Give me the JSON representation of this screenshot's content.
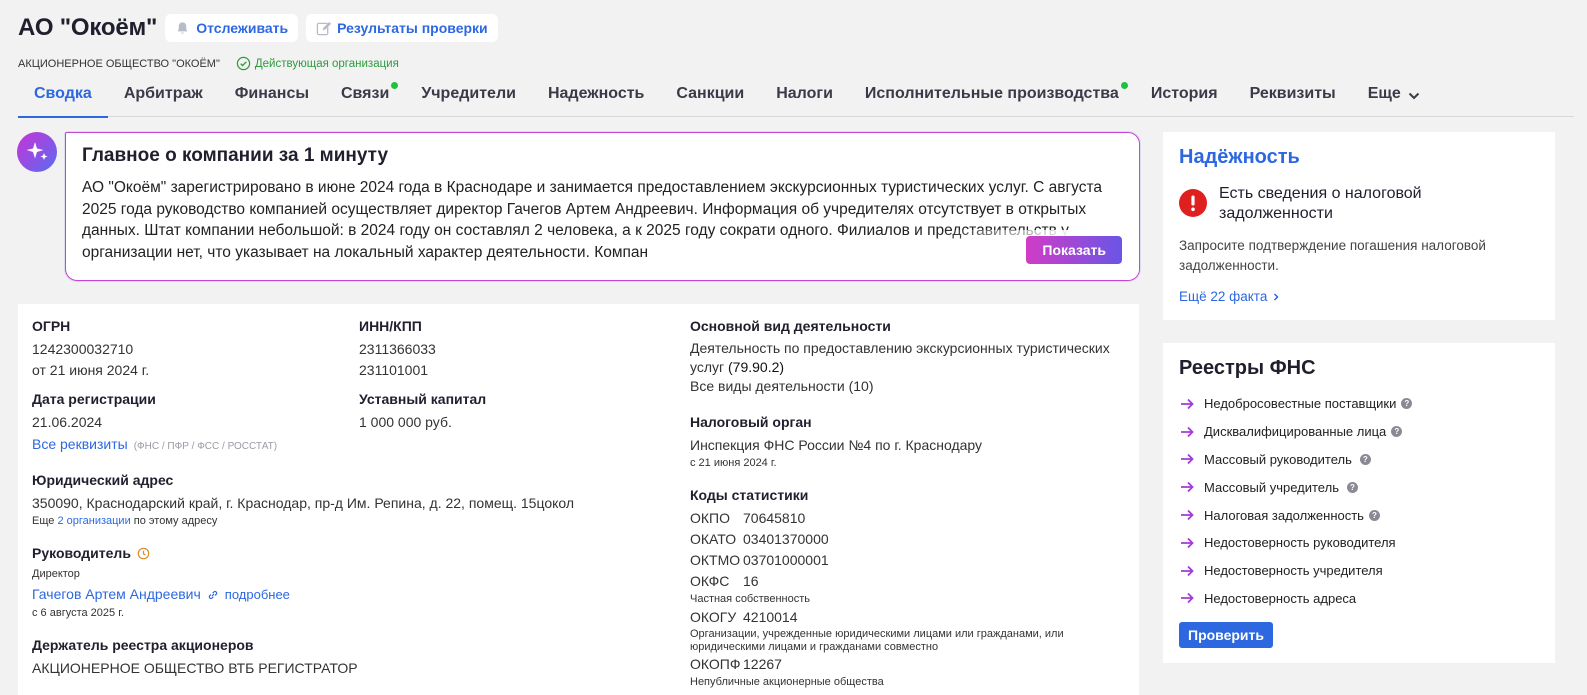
{
  "header": {
    "company_name": "АО \"Окоём\"",
    "track_label": "Отслеживать",
    "results_label": "Результаты проверки",
    "full_name": "АКЦИОНЕРНОЕ ОБЩЕСТВО \"ОКОЁМ\"",
    "status": "Действующая организация"
  },
  "tabs": [
    {
      "label": "Сводка"
    },
    {
      "label": "Арбитраж"
    },
    {
      "label": "Финансы"
    },
    {
      "label": "Связи"
    },
    {
      "label": "Учредители"
    },
    {
      "label": "Надежность"
    },
    {
      "label": "Санкции"
    },
    {
      "label": "Налоги"
    },
    {
      "label": "Исполнительные производства"
    },
    {
      "label": "История"
    },
    {
      "label": "Реквизиты"
    },
    {
      "label": "Еще"
    }
  ],
  "ai_summary": {
    "title": "Главное о компании за 1 минуту",
    "text": "АО \"Окоём\" зарегистрировано в июне 2024 года в Краснодаре и занимается предоставлением экскурсионных туристических услуг. С августа 2025 года руководство компанией осуществляет директор Гачегов Артем Андреевич. Информация об учредителях отсутствует в открытых данных. Штат компании небольшой: в 2024 году он составлял 2 человека, а к 2025 году сократи одного. Филиалов и представительств у организации нет, что указывает на локальный характер деятельности. Компан",
    "show_label": "Показать"
  },
  "details": {
    "ogrn_label": "ОГРН",
    "ogrn": "1242300032710",
    "ogrn_date": "от 21 июня 2024 г.",
    "inn_label": "ИНН/КПП",
    "inn": "2311366033",
    "kpp": "231101001",
    "reg_date_label": "Дата регистрации",
    "reg_date": "21.06.2024",
    "all_requisites": "Все реквизиты",
    "requisites_sources": "(ФНС / ПФР / ФСС / РОССТАТ)",
    "capital_label": "Уставный капитал",
    "capital": "1 000 000 руб.",
    "address_label": "Юридический адрес",
    "address": "350090, Краснодарский край, г. Краснодар, пр-д Им. Репина, д. 22, помещ. 15цокол",
    "address_note_pre": "Еще",
    "address_note_link": "2 организации",
    "address_note_post": "по этому адресу",
    "head_label": "Руководитель",
    "head_position": "Директор",
    "head_name": "Гачегов Артем Андреевич",
    "head_more": "подробнее",
    "head_since": "с 6 августа 2025 г.",
    "registrar_label": "Держатель реестра акционеров",
    "registrar": "АКЦИОНЕРНОЕ ОБЩЕСТВО ВТБ РЕГИСТРАТОР",
    "activity_label": "Основной вид деятельности",
    "activity": "Деятельность по предоставлению экскурсионных туристических услуг",
    "activity_code": "(79.90.2)",
    "all_activities": "Все виды деятельности (10)",
    "tax_label": "Налоговый орган",
    "tax_office": "Инспекция ФНС России №4 по г. Краснодару",
    "tax_since": "с 21 июня 2024 г.",
    "codes_label": "Коды статистики",
    "codes": {
      "okpo_k": "ОКПО",
      "okpo": "70645810",
      "okato_k": "ОКАТО",
      "okato": "03401370000",
      "oktmo_k": "ОКТМО",
      "oktmo": "03701000001",
      "okfs_k": "ОКФС",
      "okfs": "16",
      "okfs_desc": "Частная собственность",
      "okogu_k": "ОКОГУ",
      "okogu": "4210014",
      "okogu_desc": "Организации, учрежденные юридическими лицами или гражданами, или юридическими лицами и гражданами совместно",
      "okopf_k": "ОКОПФ",
      "okopf": "12267",
      "okopf_desc": "Непубличные акционерные общества"
    }
  },
  "reliability": {
    "title": "Надёжность",
    "warning": "Есть сведения о налоговой задолженности",
    "desc": "Запросите подтверждение погашения налоговой задолженности.",
    "more": "Ещё 22 факта"
  },
  "fns": {
    "title": "Реестры ФНС",
    "items": [
      {
        "label": "Недобросовестные поставщики"
      },
      {
        "label": "Дисквалифицированные лица"
      },
      {
        "label": "Массовый руководитель"
      },
      {
        "label": "Массовый учредитель"
      },
      {
        "label": "Налоговая задолженность"
      },
      {
        "label": "Недостоверность руководителя"
      },
      {
        "label": "Недостоверность учредителя"
      },
      {
        "label": "Недостоверность адреса"
      }
    ],
    "check_label": "Проверить"
  }
}
